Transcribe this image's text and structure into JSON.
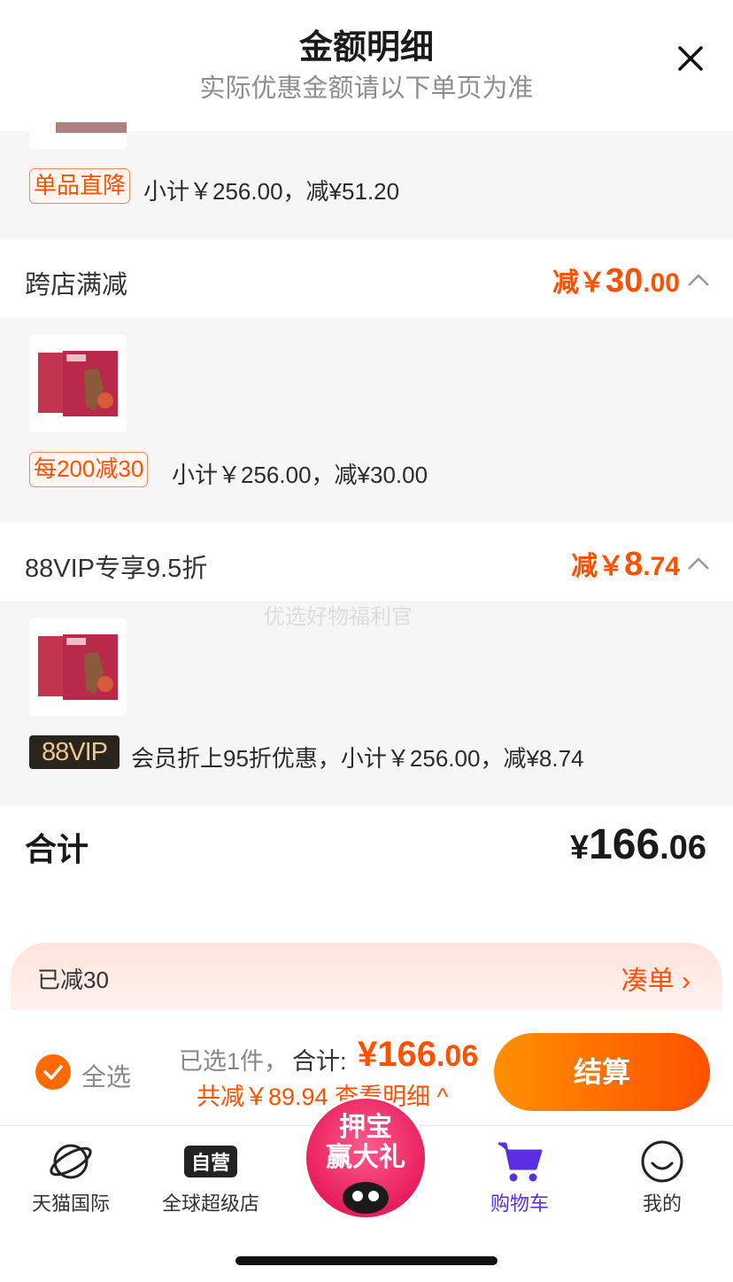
{
  "header": {
    "title": "金额明细",
    "subtitle": "实际优惠金额请以下单页为准",
    "close_icon": "close-icon"
  },
  "section_top": {
    "tag": "单品直降",
    "text": "小计￥256.00，减¥51.20"
  },
  "cross_store": {
    "label": "跨店满减",
    "amount_prefix": "减￥",
    "amount_int": "30",
    "amount_dec": ".00",
    "item_tag": "每200减30",
    "item_text": "小计￥256.00，减¥30.00"
  },
  "vip": {
    "label": "88VIP专享9.5折",
    "amount_prefix": "减￥",
    "amount_int": "8",
    "amount_dec": ".74",
    "item_tag": "88VIP",
    "item_text": "会员折上95折优惠，小计￥256.00，减¥8.74"
  },
  "watermark": "优选好物福利官",
  "total": {
    "label": "合计",
    "symbol": "¥",
    "int": "166",
    "dec": ".06"
  },
  "promo_bar": {
    "left": "已减30",
    "right": "凑单 ›"
  },
  "checkout": {
    "select_all": "全选",
    "selected": "已选1件，",
    "sum_label": "合计:",
    "sum_int": "¥166",
    "sum_dec": ".06",
    "discount": "共减￥89.94 查看明细 ^",
    "button": "结算"
  },
  "tabbar": {
    "tabs": [
      {
        "label": "天猫国际",
        "icon": "planet-icon"
      },
      {
        "label": "全球超级店",
        "icon": "self-operated-icon"
      },
      {
        "label": "购物车",
        "icon": "cart-icon"
      },
      {
        "label": "我的",
        "icon": "smile-icon"
      }
    ],
    "center_badge_line1": "押宝",
    "center_badge_line2": "赢大礼"
  },
  "colors": {
    "accent": "#ff5000",
    "cart_active": "#5b2ee6"
  }
}
